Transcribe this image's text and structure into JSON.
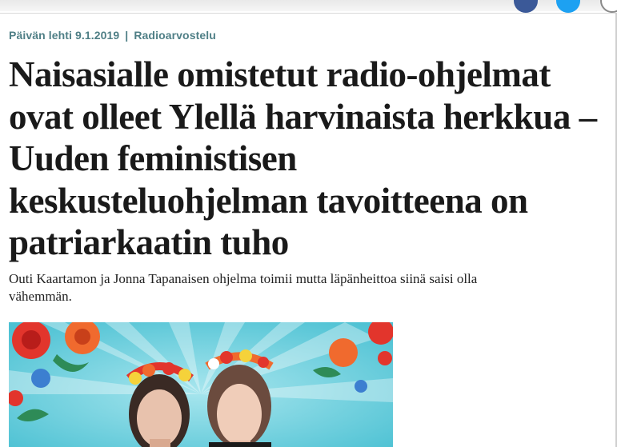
{
  "kicker": {
    "date": "Päivän lehti 9.1.2019",
    "separator": "|",
    "section": "Radioarvostelu"
  },
  "headline": {
    "lines": [
      "Naisasialle omistetut radio-ohjelmat",
      "ovat olleet Ylellä harvinaista herkkua –",
      "Uuden feministisen",
      "keskusteluohjelman tavoitteena on",
      "patriarkaatin tuho"
    ]
  },
  "lead": {
    "lines": [
      "Outi Kaartamon ja Jonna Tapanaisen ohjelma toimii mutta läpänheittoa siinä saisi olla",
      "vähemmän."
    ]
  },
  "share_icons": [
    "facebook-icon",
    "twitter-icon",
    "more-icon"
  ],
  "colors": {
    "kicker": "#4f7f86",
    "headline": "#1a1a1a",
    "hero_background": "#6fd0dd",
    "flower_red": "#e2352c"
  }
}
